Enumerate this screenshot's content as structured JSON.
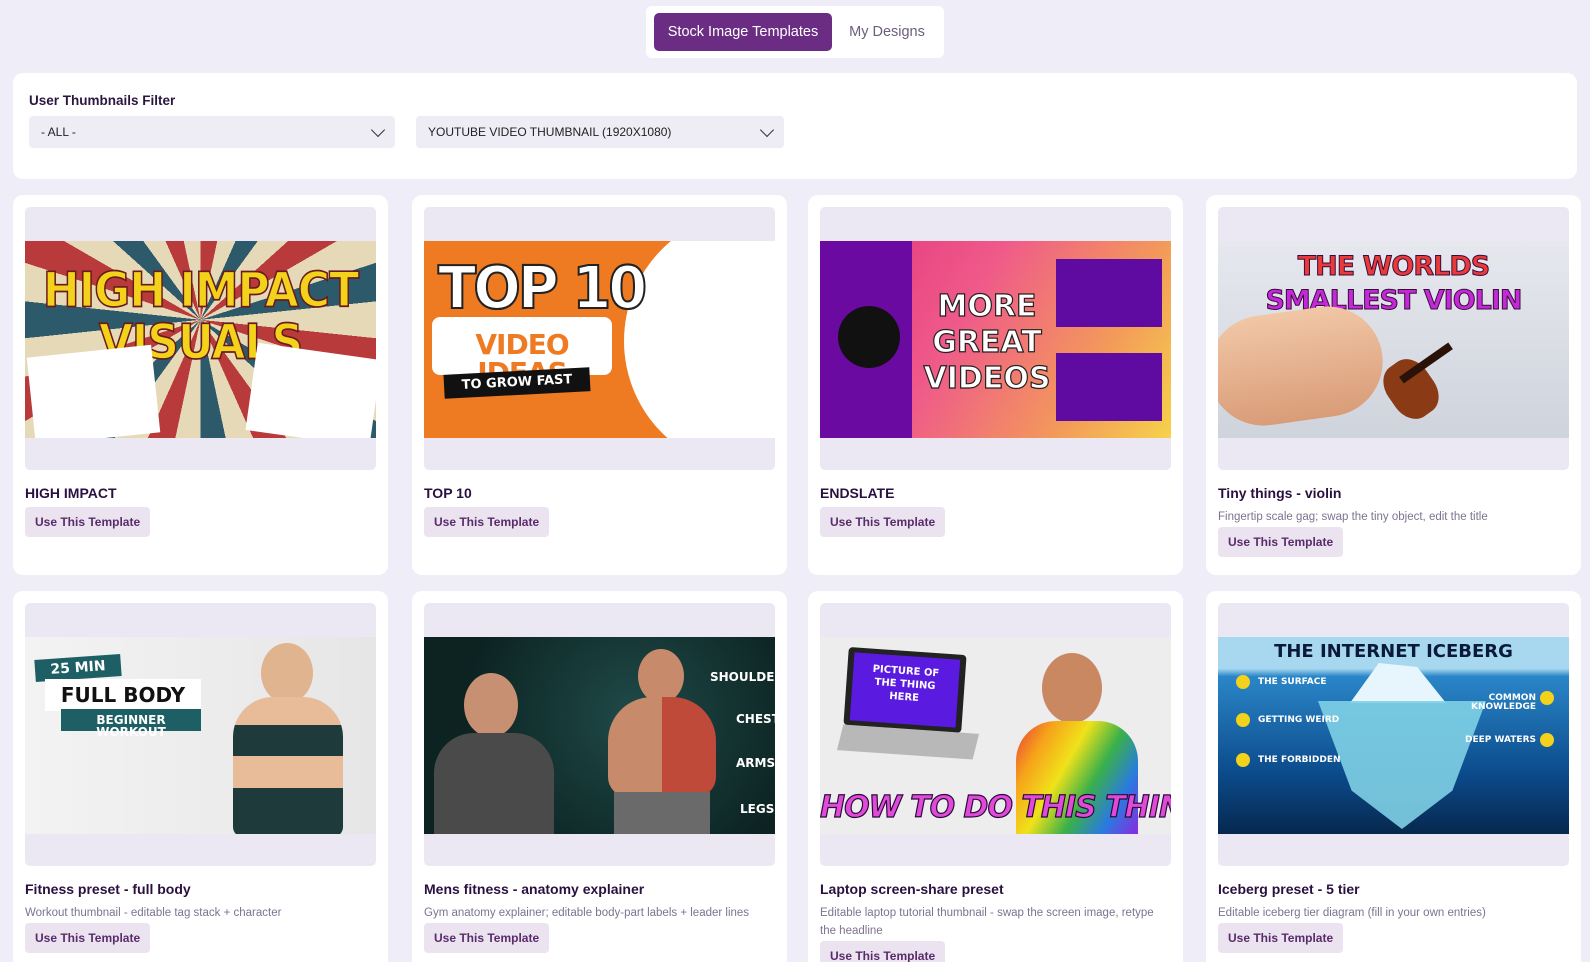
{
  "tabs": {
    "stock_label": "Stock Image Templates",
    "designs_label": "My Designs"
  },
  "filter": {
    "title": "User Thumbnails Filter",
    "category_value": "- ALL -",
    "size_value": "YOUTUBE VIDEO THUMBNAIL (1920X1080)"
  },
  "use_label": "Use This Template",
  "cards": [
    {
      "title": "HIGH IMPACT",
      "description": "",
      "thumb_text": [
        "HIGH IMPACT",
        "VISUALS"
      ]
    },
    {
      "title": "TOP 10",
      "description": "",
      "thumb_text": [
        "TOP 10",
        "VIDEO IDEAS",
        "TO GROW FAST"
      ]
    },
    {
      "title": "ENDSLATE",
      "description": "",
      "thumb_text": [
        "MORE",
        "GREAT",
        "VIDEOS"
      ]
    },
    {
      "title": "Tiny things - violin",
      "description": "Fingertip scale gag; swap the tiny object, edit the title",
      "thumb_text": [
        "THE WORLDS",
        "SMALLEST VIOLIN"
      ]
    },
    {
      "title": "Fitness preset - full body",
      "description": "Workout thumbnail - editable tag stack + character",
      "thumb_text": [
        "25 MIN",
        "FULL BODY",
        "BEGINNER WORKOUT"
      ]
    },
    {
      "title": "Mens fitness - anatomy explainer",
      "description": "Gym anatomy explainer; editable body-part labels + leader lines",
      "thumb_text": [
        "SHOULDERS",
        "CHEST",
        "ARMS",
        "LEGS"
      ]
    },
    {
      "title": "Laptop screen-share preset",
      "description": "Editable laptop tutorial thumbnail - swap the screen image, retype the headline",
      "thumb_text": [
        "PICTURE OF THE THING HERE",
        "HOW TO DO THIS THING!"
      ]
    },
    {
      "title": "Iceberg preset - 5 tier",
      "description": "Editable iceberg tier diagram (fill in your own entries)",
      "thumb_text": [
        "THE INTERNET ICEBERG",
        "THE SURFACE",
        "COMMON KNOWLEDGE",
        "GETTING WEIRD",
        "DEEP WATERS",
        "THE FORBIDDEN"
      ]
    }
  ],
  "colors": {
    "accent": "#6b2d83",
    "page_bg": "#efedf7",
    "button_bg": "#ebe3ef"
  }
}
